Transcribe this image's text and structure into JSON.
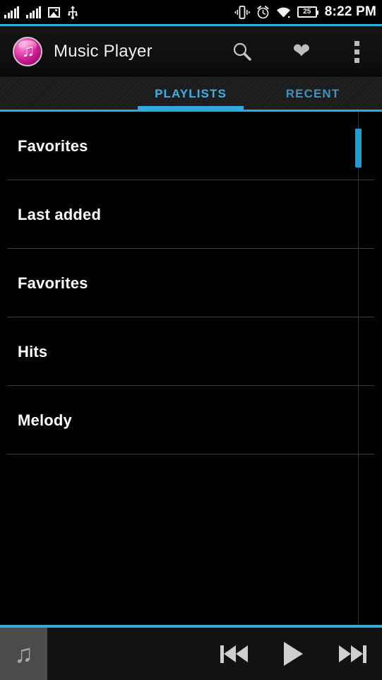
{
  "status_bar": {
    "signal_icon_1": "signal-bars-icon",
    "signal_icon_2": "signal-bars-icon",
    "image_icon": "image-icon",
    "usb_icon": "usb-icon",
    "vibrate_icon": "vibrate-icon",
    "alarm_icon": "alarm-clock-icon",
    "wifi_icon": "wifi-icon",
    "battery_icon": "battery-icon",
    "battery_level": "25",
    "time": "8:22 PM"
  },
  "action_bar": {
    "app_icon": "music-note-app-icon",
    "title": "Music Player",
    "search_icon": "search-icon",
    "favorites_icon": "heart-icon",
    "overflow_icon": "overflow-menu-icon"
  },
  "tabs": {
    "items": [
      {
        "label": "PLAYLISTS",
        "active": true
      },
      {
        "label": "RECENT",
        "active": false
      }
    ]
  },
  "playlists": {
    "items": [
      {
        "name": "Favorites"
      },
      {
        "name": "Last added"
      },
      {
        "name": "Favorites"
      },
      {
        "name": "Hits"
      },
      {
        "name": "Melody"
      }
    ]
  },
  "player_bar": {
    "album_art_icon": "music-note-icon",
    "previous_icon": "skip-previous-icon",
    "play_icon": "play-icon",
    "next_icon": "skip-next-icon"
  },
  "colors": {
    "accent_blue": "#2fa8dd",
    "tab_active_blue": "#3ab0e8",
    "tab_inactive_blue": "#3c93bd",
    "scrollbar_blue": "#1a9fd4",
    "background": "#000000",
    "divider": "#3b3b3b",
    "album_art_bg": "#4b4b4b"
  }
}
